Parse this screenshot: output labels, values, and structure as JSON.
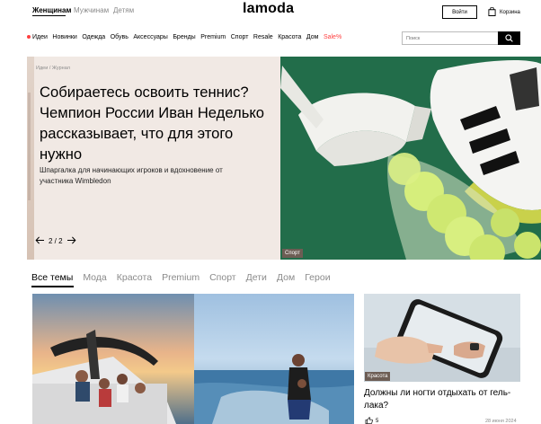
{
  "header": {
    "genders": [
      "Женщинам",
      "Мужчинам",
      "Детям"
    ],
    "logo": "lamoda",
    "login_label": "Войти",
    "cart_label": "Корзина",
    "cart_icon": "bag-icon"
  },
  "nav": {
    "items": [
      "Идеи",
      "Новинки",
      "Одежда",
      "Обувь",
      "Аксессуары",
      "Бренды",
      "Premium",
      "Спорт",
      "Resale",
      "Красота",
      "Дом",
      "Sale%"
    ],
    "search_placeholder": "Поиск",
    "search_icon": "search-icon",
    "colors": {
      "sale": "#ff3f3f",
      "ideas_dot": "#ff3f3f"
    }
  },
  "hero": {
    "breadcrumb": [
      "Идеи",
      "Журнал"
    ],
    "title": "Собираетесь освоить теннис? Чемпион России Иван Неделько рассказывает, что для этого нужно",
    "subtitle": "Шпаргалка для начинающих игроков и вдохновение от участника Wimbledon",
    "pager": "2 / 2",
    "image_tag": "Спорт",
    "colors": {
      "panel_bg": "#f1e9e4",
      "image_bg": "#1f6b4a"
    }
  },
  "tabs": [
    "Все темы",
    "Мода",
    "Красота",
    "Premium",
    "Спорт",
    "Дети",
    "Дом",
    "Герои"
  ],
  "cards": {
    "small": {
      "tag": "Красота",
      "title": "Должны ли ногти отдыхать от гель-лака?",
      "likes": "5",
      "date": "28 июня 2024"
    }
  }
}
